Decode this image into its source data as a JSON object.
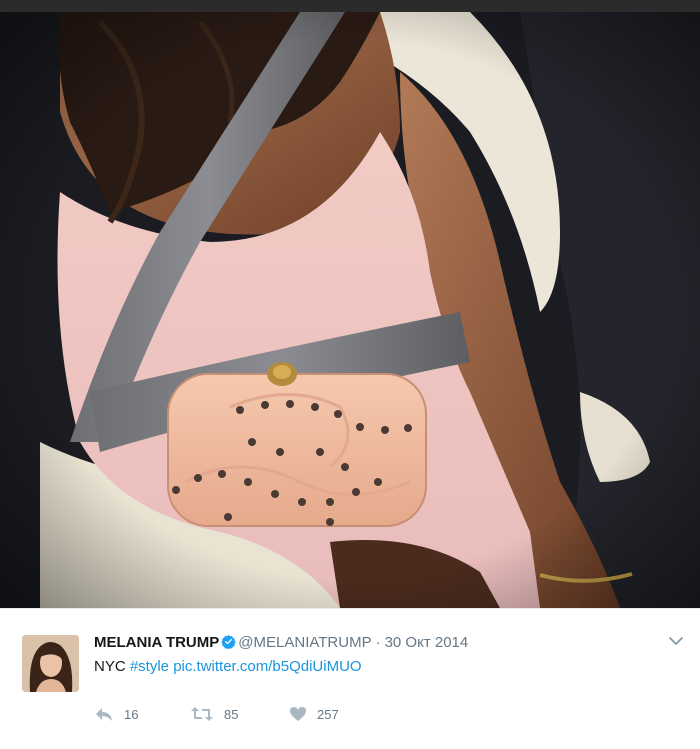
{
  "tweet": {
    "author_name": "MELANIA TRUMP",
    "handle": "@MELANIATRUMP",
    "separator": "·",
    "date": "30 Окт 2014",
    "text_prefix": "NYC",
    "hashtag": "#style",
    "photo_link": "pic.twitter.com/b5QdiUiMUO",
    "replies": "16",
    "retweets": "85",
    "likes": "257",
    "verified": true
  },
  "icons": {
    "verified": "verified-badge-icon",
    "more": "chevron-down-icon",
    "reply": "reply-icon",
    "retweet": "retweet-icon",
    "like": "heart-icon"
  },
  "colors": {
    "link": "#1b95e0",
    "muted": "#657786",
    "text": "#14171a",
    "verified": "#1da1f2"
  }
}
